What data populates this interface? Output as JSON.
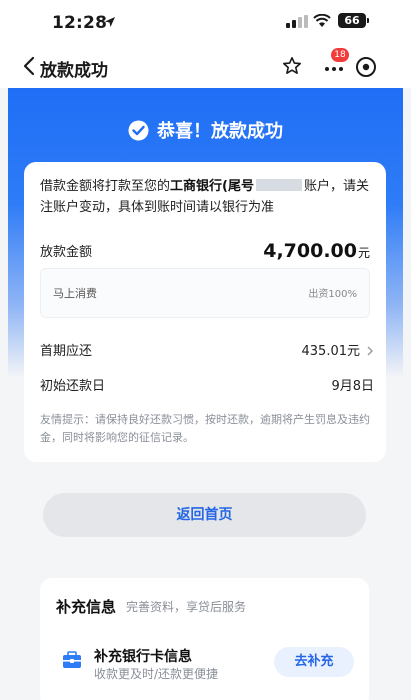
{
  "status_bar": {
    "time": "12:28",
    "battery": "66"
  },
  "nav": {
    "title": "放款成功",
    "badge": "18"
  },
  "hero": {
    "title": "恭喜！放款成功"
  },
  "loan": {
    "notice_pre": "借款金额将打款至您的",
    "bank": "工商银行(尾号",
    "notice_post": "账户，请关注账户变动，具体到账时间请以银行为准",
    "amount_label": "放款金额",
    "amount": "4,700.00",
    "amount_unit": "元",
    "merchant": "马上消费",
    "merchant_share": "出资100%",
    "first_repay_label": "首期应还",
    "first_repay_value": "435.01元",
    "first_date_label": "初始还款日",
    "first_date_value": "9月8日",
    "tips": "友情提示：请保持良好还款习惯，按时还款，逾期将产生罚息及违约金，同时将影响您的征信记录。"
  },
  "home_button": "返回首页",
  "supplement": {
    "title": "补充信息",
    "subtitle": "完善资料，享贷后服务",
    "item_title": "补充银行卡信息",
    "item_desc": "收款更及时/还款更便捷",
    "item_button": "去补充"
  },
  "colors": {
    "primary": "#2466e6",
    "hero": "#1f6ef5",
    "badge": "#f23c3c"
  }
}
